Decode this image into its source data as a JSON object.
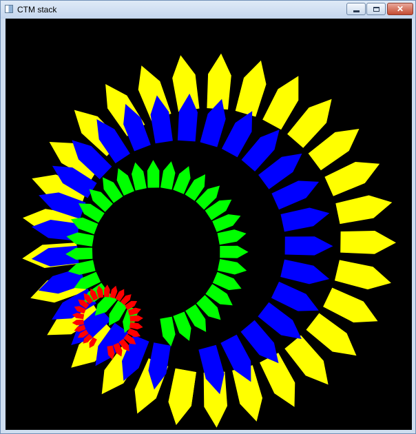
{
  "window": {
    "title": "CTM stack",
    "buttons": {
      "minimize": "minimize",
      "maximize": "maximize",
      "close": "✕"
    }
  },
  "canvas": {
    "background": "#000000",
    "colors": {
      "yellow": "#ffff00",
      "blue": "#0000ff",
      "green": "#00ff00",
      "red": "#ff0000"
    },
    "rings": [
      {
        "name": "yellow",
        "color": "#ffff00",
        "count": 30
      },
      {
        "name": "blue",
        "color": "#0000ff",
        "count": 28
      },
      {
        "name": "green",
        "color": "#00ff00",
        "count": 30
      },
      {
        "name": "red",
        "color": "#ff0000",
        "count": 24
      }
    ]
  }
}
